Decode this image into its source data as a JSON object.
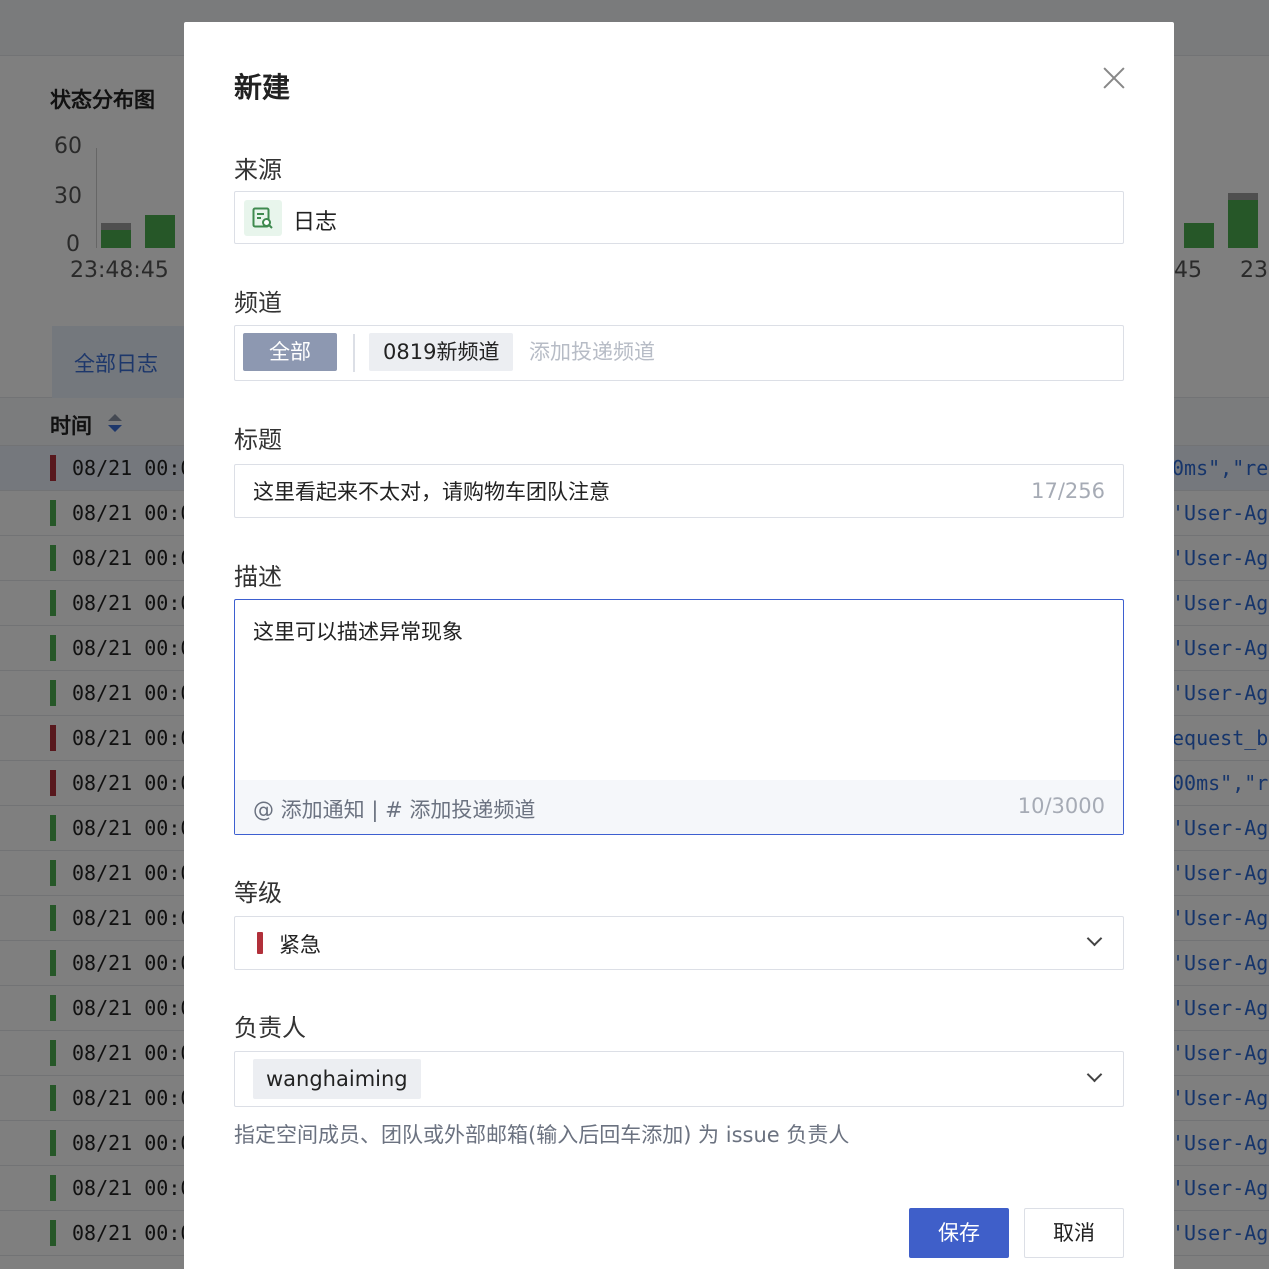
{
  "background": {
    "chart": {
      "title": "状态分布图",
      "y_ticks": [
        "60",
        "30",
        "0"
      ],
      "x_ticks_left": "23:48:45",
      "x_ticks_right": [
        "45",
        "23:"
      ]
    },
    "tab_label": "全部日志",
    "column_header": "时间",
    "row_time": "08/21 00:0",
    "rows": [
      {
        "level": "error",
        "tail": "0ms\",\"re"
      },
      {
        "level": "ok",
        "tail": "'User-Age"
      },
      {
        "level": "ok",
        "tail": "'User-Age"
      },
      {
        "level": "ok",
        "tail": "'User-Age"
      },
      {
        "level": "ok",
        "tail": "'User-Age"
      },
      {
        "level": "ok",
        "tail": "'User-Age"
      },
      {
        "level": "error",
        "tail": "equest_bo"
      },
      {
        "level": "error",
        "tail": "00ms\",\"re"
      },
      {
        "level": "ok",
        "tail": "'User-Age"
      },
      {
        "level": "ok",
        "tail": "'User-Age"
      },
      {
        "level": "ok",
        "tail": "'User-Age"
      },
      {
        "level": "ok",
        "tail": "'User-Age"
      },
      {
        "level": "ok",
        "tail": "'User-Age"
      },
      {
        "level": "ok",
        "tail": "'User-Age"
      },
      {
        "level": "ok",
        "tail": "'User-Age"
      },
      {
        "level": "ok",
        "tail": "'User-Age"
      },
      {
        "level": "ok",
        "tail": "'User-Age"
      },
      {
        "level": "ok",
        "tail": "'User-Age"
      }
    ],
    "colors": {
      "ok": "#4caf50",
      "error": "#b1303a"
    }
  },
  "modal": {
    "title": "新建",
    "source": {
      "label": "来源",
      "value": "日志"
    },
    "channel": {
      "label": "频道",
      "all_tag": "全部",
      "selected_channel": "0819新频道",
      "placeholder": "添加投递频道"
    },
    "issue_title": {
      "label": "标题",
      "value": "这里看起来不太对，请购物车团队注意",
      "counter": "17/256"
    },
    "description": {
      "label": "描述",
      "value": "这里可以描述异常现象",
      "helper": "@ 添加通知 | # 添加投递频道",
      "counter": "10/3000"
    },
    "level": {
      "label": "等级",
      "value": "紧急",
      "color": "#b1303a"
    },
    "assignee": {
      "label": "负责人",
      "value": "wanghaiming",
      "hint": "指定空间成员、团队或外部邮箱(输入后回车添加) 为 issue 负责人"
    },
    "buttons": {
      "save": "保存",
      "cancel": "取消"
    },
    "colors": {
      "primary": "#3f5fc9"
    }
  }
}
